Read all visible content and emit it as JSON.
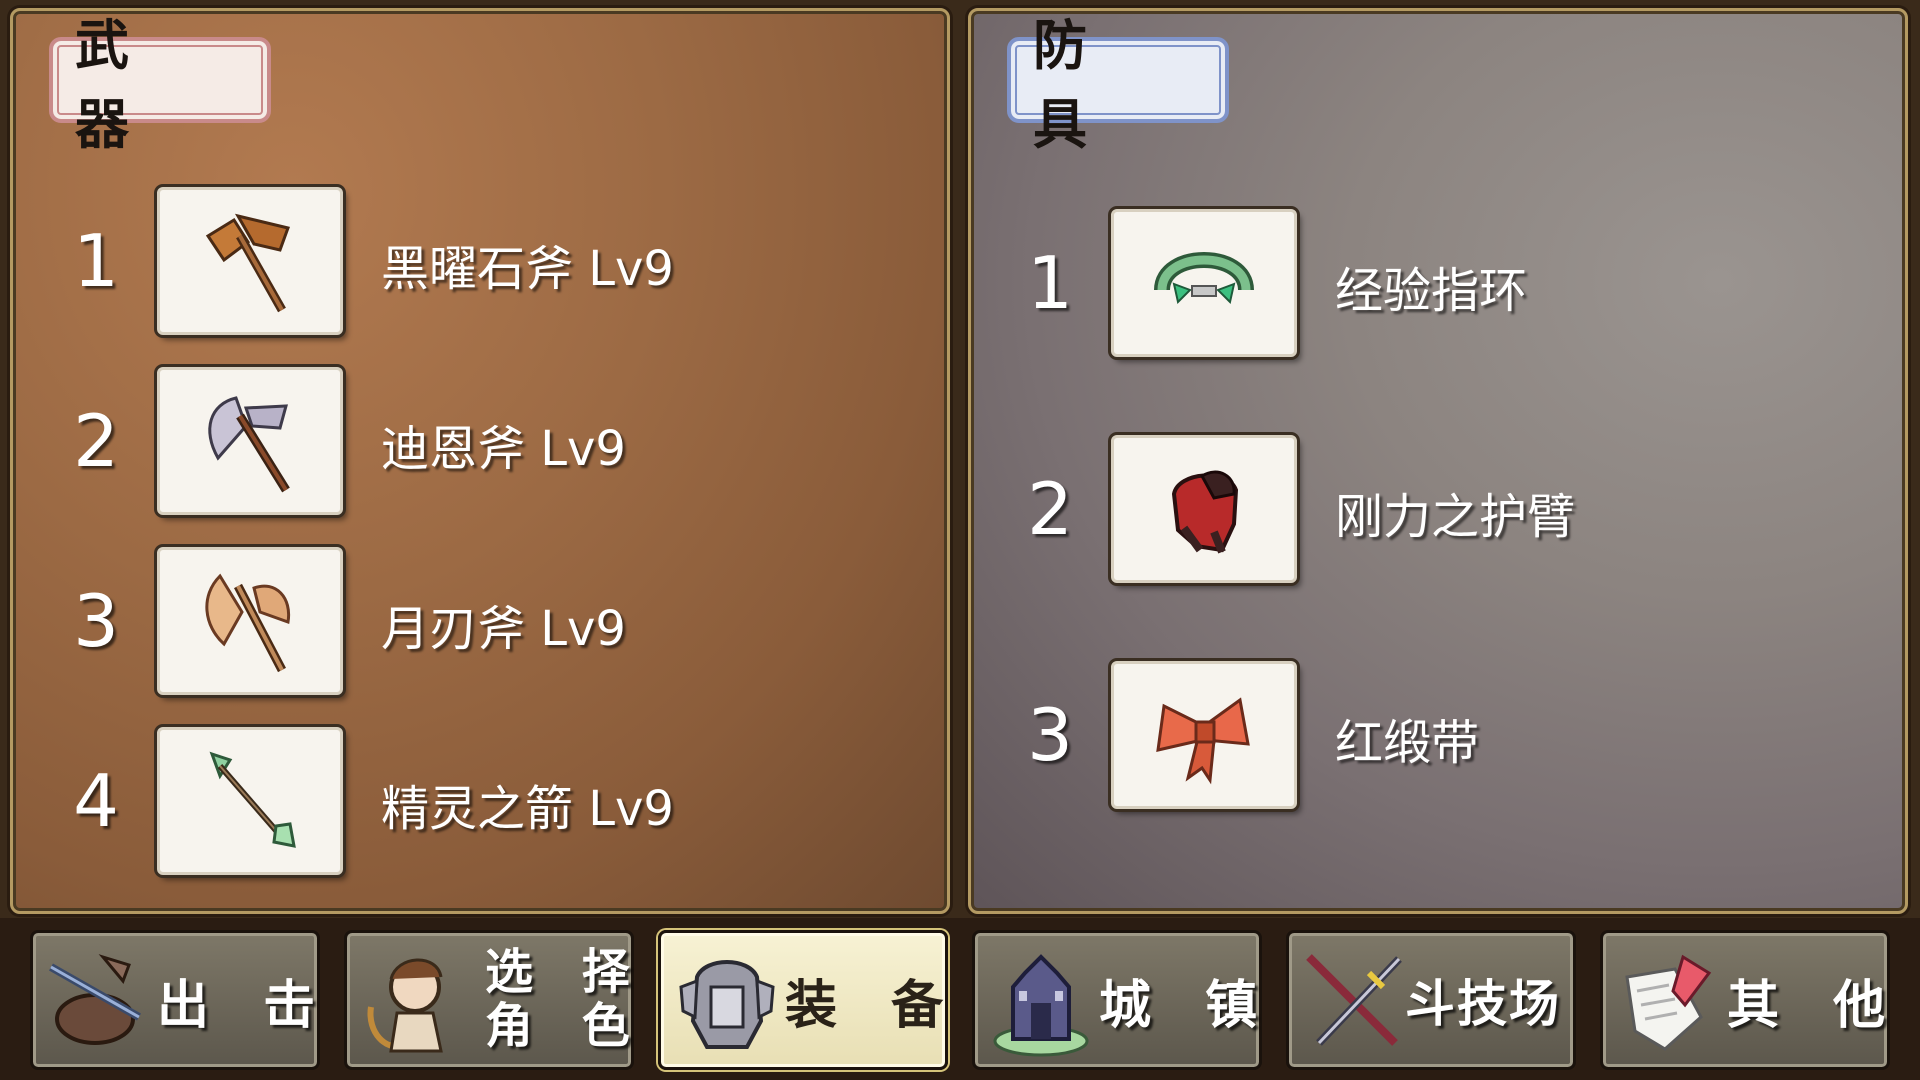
{
  "weapons": {
    "title": "武 器",
    "items": [
      {
        "num": "1",
        "name": "黑曜石斧 Lv9",
        "icon": "obsidian-axe-icon"
      },
      {
        "num": "2",
        "name": "迪恩斧 Lv9",
        "icon": "dean-axe-icon"
      },
      {
        "num": "3",
        "name": "月刃斧 Lv9",
        "icon": "moon-blade-axe-icon"
      },
      {
        "num": "4",
        "name": "精灵之箭 Lv9",
        "icon": "elf-arrow-icon"
      }
    ]
  },
  "armor": {
    "title": "防 具",
    "items": [
      {
        "num": "1",
        "name": "经验指环",
        "icon": "exp-ring-icon"
      },
      {
        "num": "2",
        "name": "刚力之护臂",
        "icon": "strength-bracer-icon"
      },
      {
        "num": "3",
        "name": "红缎带",
        "icon": "red-ribbon-icon"
      }
    ]
  },
  "nav": [
    {
      "label": "出 击",
      "icon": "sortie-icon"
    },
    {
      "label_line1": "选 择",
      "label_line2": "角 色",
      "icon": "character-icon"
    },
    {
      "label": "装 备",
      "icon": "equipment-icon",
      "active": true
    },
    {
      "label": "城 镇",
      "icon": "town-icon"
    },
    {
      "label": "斗技场",
      "icon": "arena-icon"
    },
    {
      "label": "其 他",
      "icon": "other-icon"
    }
  ],
  "colors": {
    "weapon_panel": "#9c6a44",
    "armor_panel": "#8c8480",
    "weapon_tag_border": "#c98a8a",
    "armor_tag_border": "#7f93c9",
    "active_tab": "#f7f2d4"
  }
}
